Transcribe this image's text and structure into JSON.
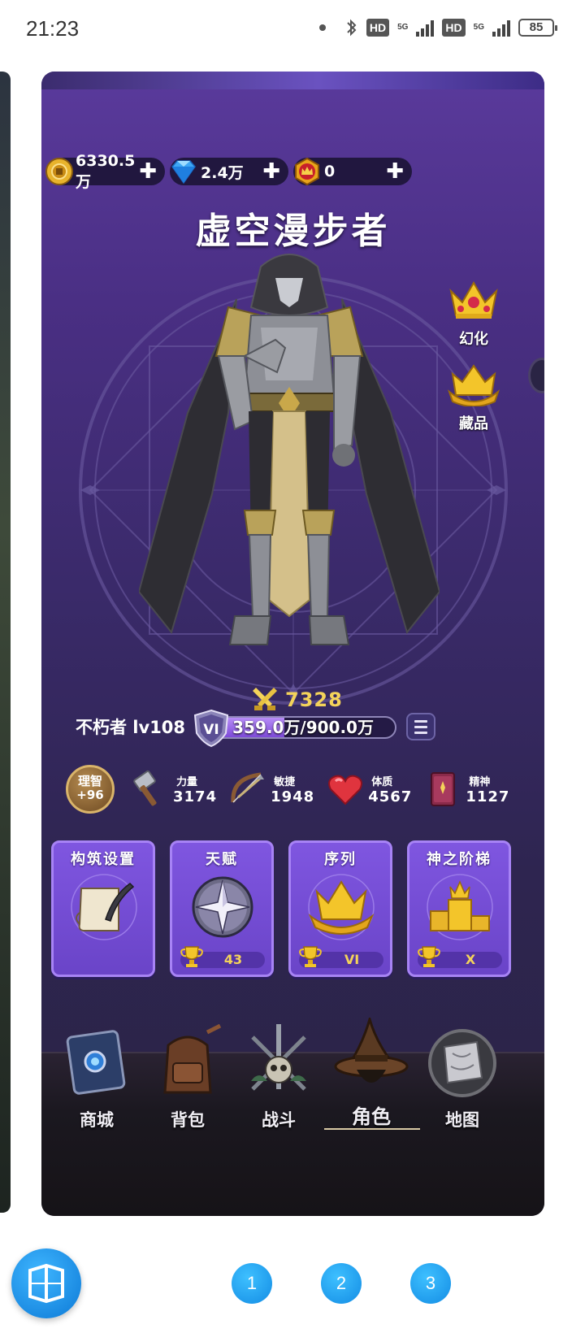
{
  "status_bar": {
    "time": "21:23",
    "hd1": "HD",
    "net1": "5G",
    "hd2": "HD",
    "net2": "5G",
    "battery": "85"
  },
  "currencies": [
    {
      "icon": "gold-coin-icon",
      "value": "6330.5万"
    },
    {
      "icon": "diamond-icon",
      "value": "2.4万"
    },
    {
      "icon": "crown-coin-icon",
      "value": "0"
    }
  ],
  "character": {
    "name": "虚空漫步者",
    "power": "7328",
    "title_level": "不朽者 lv108",
    "rank": "VI",
    "exp_text": "359.0万/900.0万",
    "exp_fraction": 0.399
  },
  "side_buttons": {
    "transform": "幻化",
    "collection": "藏品"
  },
  "wisdom": {
    "line1": "理智",
    "line2": "+96"
  },
  "stats": [
    {
      "name": "力量",
      "value": "3174",
      "icon": "hammer-icon"
    },
    {
      "name": "敏捷",
      "value": "1948",
      "icon": "bow-icon"
    },
    {
      "name": "体质",
      "value": "4567",
      "icon": "heart-icon"
    },
    {
      "name": "精神",
      "value": "1127",
      "icon": "book-icon"
    }
  ],
  "cards": [
    {
      "title": "构筑设置",
      "icon": "scroll-quill-icon",
      "footer": null
    },
    {
      "title": "天赋",
      "icon": "compass-star-icon",
      "footer": "43"
    },
    {
      "title": "序列",
      "icon": "crown-icon",
      "footer": "VI"
    },
    {
      "title": "神之阶梯",
      "icon": "podium-icon",
      "footer": "X"
    }
  ],
  "nav": [
    {
      "label": "商城",
      "icon": "shop-book-icon"
    },
    {
      "label": "背包",
      "icon": "backpack-icon"
    },
    {
      "label": "战斗",
      "icon": "battle-skull-icon"
    },
    {
      "label": "角色",
      "icon": "wizard-hat-icon",
      "active": true
    },
    {
      "label": "地图",
      "icon": "map-icon"
    }
  ],
  "pager": [
    "1",
    "2",
    "3"
  ],
  "colors": {
    "accent_purple": "#7f56e0",
    "gold": "#f4d35a",
    "launcher_blue": "#138ce4"
  }
}
